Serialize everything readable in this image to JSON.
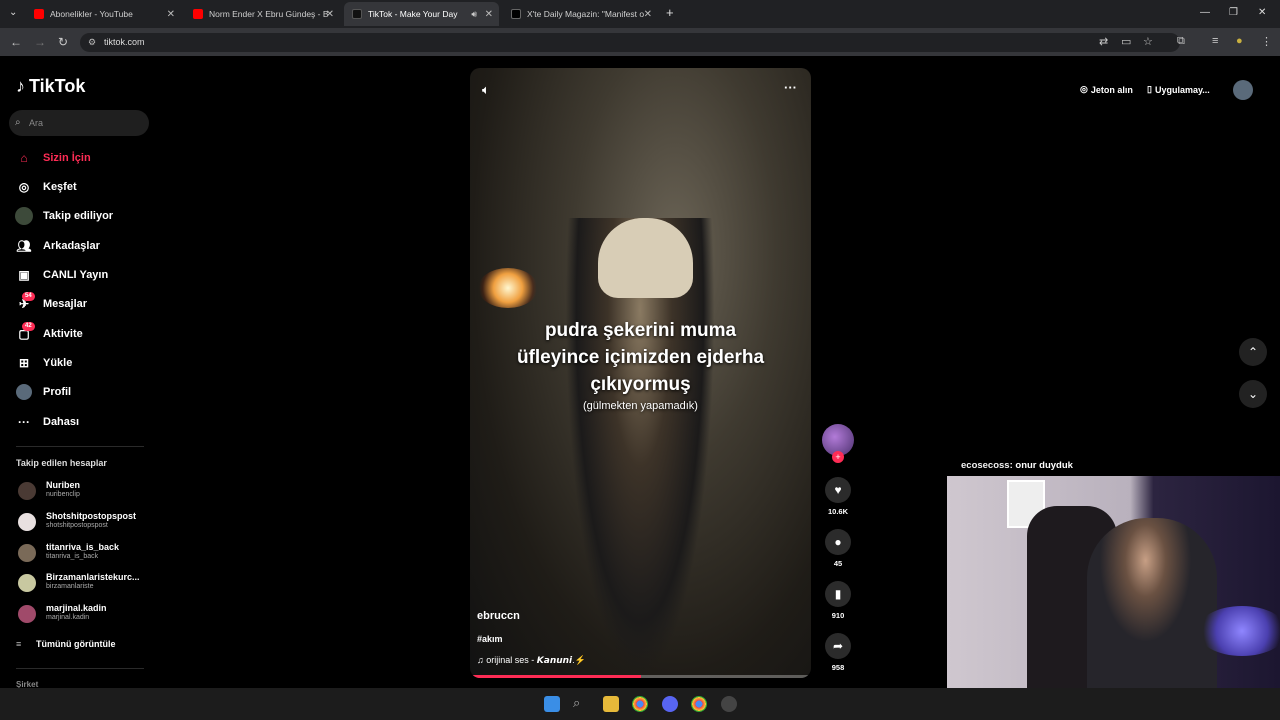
{
  "browser": {
    "tabs": [
      {
        "title": "Abonelikler - YouTube",
        "color": "#ff0000"
      },
      {
        "title": "Norm Ender X Ebru Gündeş - B",
        "color": "#ff0000"
      },
      {
        "title": "TikTok - Make Your Day",
        "color": "#111111"
      },
      {
        "title": "X'te Daily Magazin: \"Manifest o",
        "color": "#000000"
      }
    ],
    "new_tab": "+",
    "url": "tiktok.com"
  },
  "sidebar": {
    "logo": "TikTok",
    "search_placeholder": "Ara",
    "nav": [
      {
        "label": "Sizin İçin",
        "icon": "home-icon"
      },
      {
        "label": "Keşfet",
        "icon": "compass-icon"
      },
      {
        "label": "Takip ediliyor",
        "icon": "following-icon"
      },
      {
        "label": "Arkadaşlar",
        "icon": "friends-icon"
      },
      {
        "label": "CANLI Yayın",
        "icon": "live-icon"
      },
      {
        "label": "Mesajlar",
        "icon": "messages-icon",
        "badge": "54"
      },
      {
        "label": "Aktivite",
        "icon": "activity-icon",
        "badge": "42"
      },
      {
        "label": "Yükle",
        "icon": "upload-icon"
      },
      {
        "label": "Profil",
        "icon": "profile-icon"
      },
      {
        "label": "Dahası",
        "icon": "more-icon"
      }
    ],
    "following_title": "Takip edilen hesaplar",
    "following": [
      {
        "name": "Nuriben",
        "handle": "nuribenclip"
      },
      {
        "name": "Shotshitpostopspost",
        "handle": "shotshitpostopspost"
      },
      {
        "name": "titanriva_is_back",
        "handle": "titanriva_is_back"
      },
      {
        "name": "Birzamanlaristekurc...",
        "handle": "birzamanlariste"
      },
      {
        "name": "marjinal.kadin",
        "handle": "marjinal.kadin"
      }
    ],
    "see_all": "Tümünü görüntüle",
    "company": "Şirket"
  },
  "top_right": {
    "coins": "Jeton alın",
    "app": "Uygulamay..."
  },
  "video": {
    "caption_lines": [
      "pudra şekerini muma",
      "üfleyince içimizden ejderha",
      "çıkıyormuş"
    ],
    "subcaption": "(gülmekten yapamadık)",
    "author": "ebruccn",
    "hashtag": "#akım",
    "sound": "orijinal ses - 𝙆𝙖𝙣𝙪𝙣𝙞.⚡",
    "progress": 0.5,
    "likes": "10.6K",
    "comments": "45",
    "saves": "910",
    "shares": "958"
  },
  "stream": {
    "chat_user": "ecosecoss",
    "chat_text": ": onur duyduk"
  }
}
